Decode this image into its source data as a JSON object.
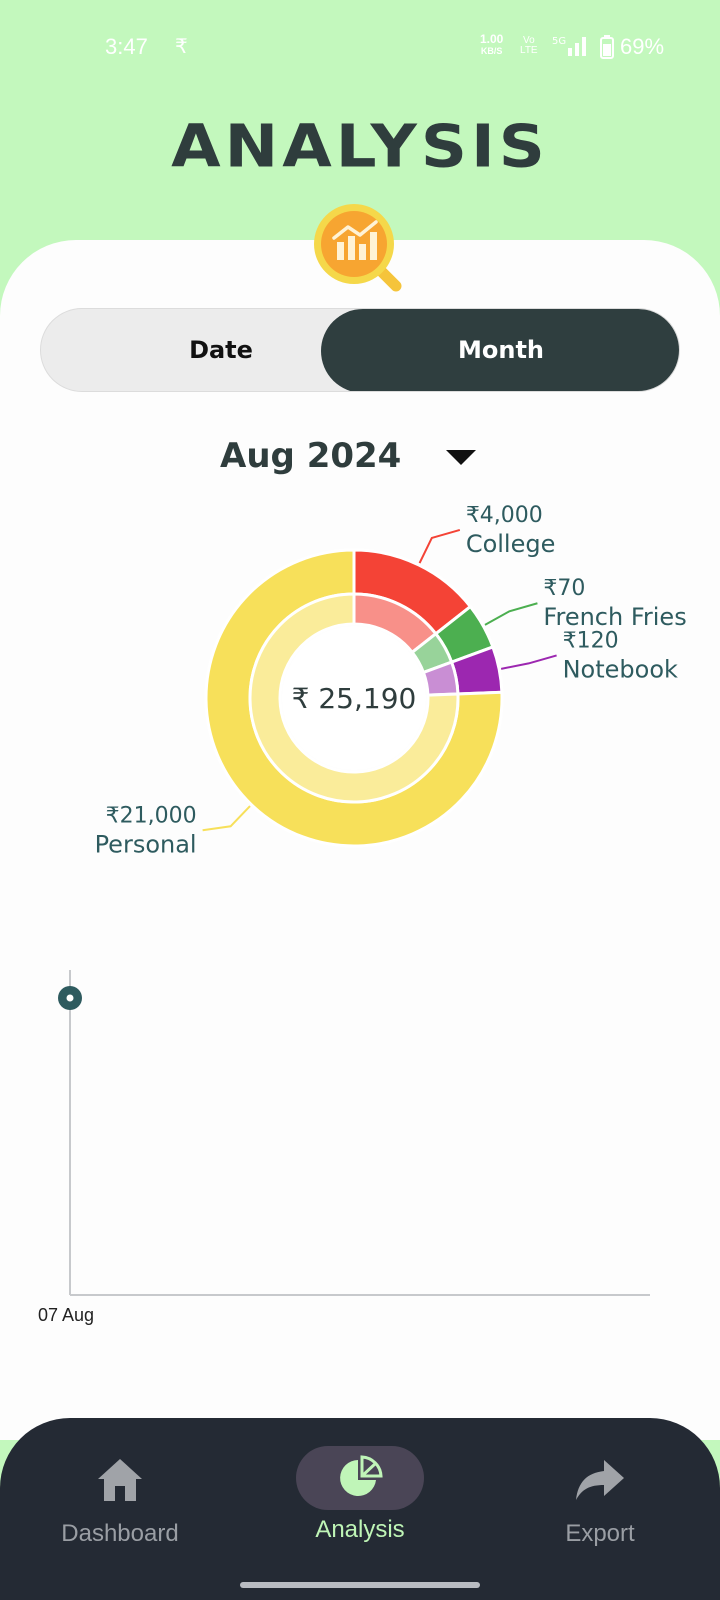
{
  "status_bar": {
    "time": "3:47",
    "notification_icon": "rupee-icon",
    "net_speed_value": "1.00",
    "net_speed_unit": "KB/S",
    "volte_top": "Vo",
    "volte_bottom": "LTE",
    "network": "5G",
    "battery": "69%"
  },
  "header": {
    "title": "ANALYSIS",
    "badge_icon": "analysis-magnifier-icon"
  },
  "toggle": {
    "date_label": "Date",
    "month_label": "Month",
    "selected": "Month"
  },
  "month_selector": {
    "value": "Aug 2024",
    "icon": "caret-down-icon"
  },
  "chart_data": [
    {
      "type": "pie",
      "variant": "donut",
      "center_label": "₹ 25,190",
      "slices": [
        {
          "label": "College",
          "amount_label": "₹4,000",
          "value": 4000,
          "color": "#f44336",
          "inner_color": "#f89089"
        },
        {
          "label": "French Fries",
          "amount_label": "₹70",
          "value": 70,
          "color": "#4caf50",
          "inner_color": "#98d39a"
        },
        {
          "label": "Notebook",
          "amount_label": "₹120",
          "value": 120,
          "color": "#9c27b0",
          "inner_color": "#c98ed4"
        },
        {
          "label": "Personal",
          "amount_label": "₹21,000",
          "value": 21000,
          "color": "#f7e05a",
          "inner_color": "#faec9a"
        }
      ]
    },
    {
      "type": "line",
      "x": [
        "07 Aug"
      ],
      "series": [
        {
          "values": [
            25190
          ],
          "color": "#2e5b5f"
        }
      ],
      "grid": false
    }
  ],
  "bottom_nav": {
    "items": [
      {
        "label": "Dashboard",
        "icon": "home-icon",
        "active": false
      },
      {
        "label": "Analysis",
        "icon": "pie-chart-icon",
        "active": true
      },
      {
        "label": "Export",
        "icon": "share-arrow-icon",
        "active": false
      }
    ]
  }
}
